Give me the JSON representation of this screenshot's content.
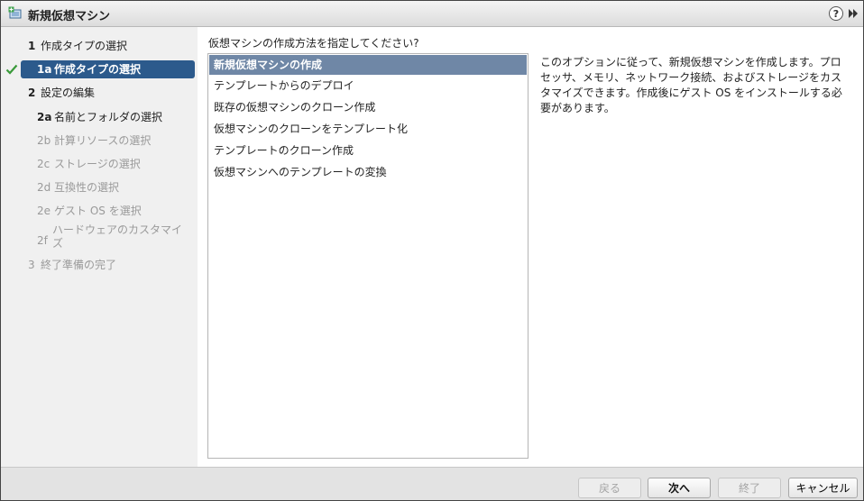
{
  "window": {
    "title": "新規仮想マシン",
    "help_glyph": "?"
  },
  "steps": [
    {
      "num": "1",
      "label": "作成タイプの選択"
    },
    {
      "num": "1a",
      "label": "作成タイプの選択"
    },
    {
      "num": "2",
      "label": "設定の編集"
    },
    {
      "num": "2a",
      "label": "名前とフォルダの選択"
    },
    {
      "num": "2b",
      "label": "計算リソースの選択"
    },
    {
      "num": "2c",
      "label": "ストレージの選択"
    },
    {
      "num": "2d",
      "label": "互換性の選択"
    },
    {
      "num": "2e",
      "label": "ゲスト OS を選択"
    },
    {
      "num": "2f",
      "label_line1": "ハードウェアのカスタマイ",
      "label_line2": "ズ"
    },
    {
      "num": "3",
      "label": "終了準備の完了"
    }
  ],
  "main": {
    "prompt": "仮想マシンの作成方法を指定してください?",
    "options": [
      "新規仮想マシンの作成",
      "テンプレートからのデプロイ",
      "既存の仮想マシンのクローン作成",
      "仮想マシンのクローンをテンプレート化",
      "テンプレートのクローン作成",
      "仮想マシンへのテンプレートの変換"
    ],
    "description_lines": [
      "このオプションに従って、新規仮想マシンを作成します。プロ",
      "セッサ、メモリ、ネットワーク接続、およびストレージをカス",
      "タマイズできます。作成後にゲスト OS をインストールする必",
      "要があります。"
    ]
  },
  "footer": {
    "back": "戻る",
    "next": "次へ",
    "finish": "終了",
    "cancel": "キャンセル"
  },
  "colors": {
    "active_step": "#2c5a8c",
    "selected_option": "#6f87a6",
    "check": "#3a9a3a"
  }
}
